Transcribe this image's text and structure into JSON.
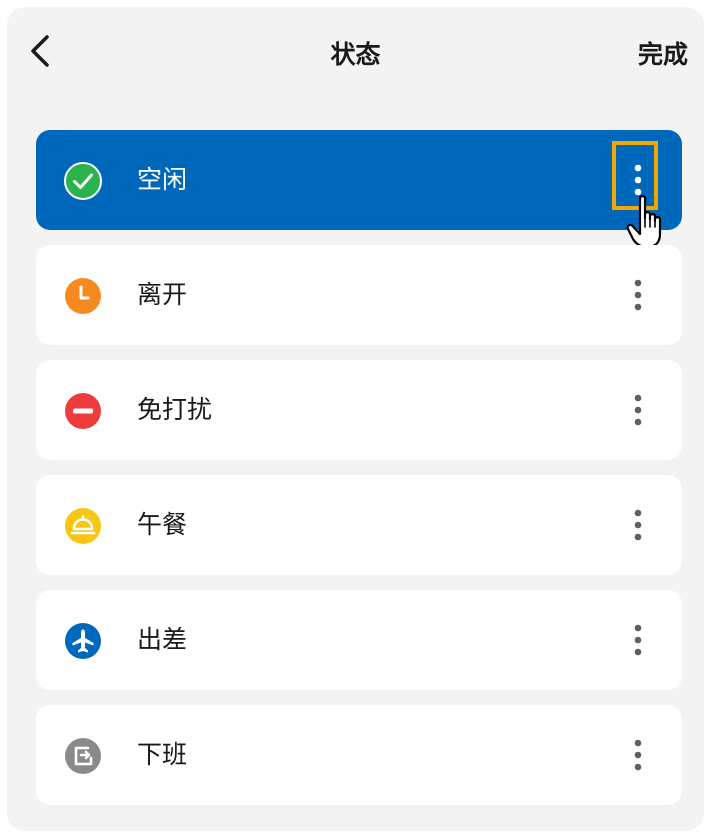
{
  "header": {
    "title": "状态",
    "done_label": "完成",
    "back_icon": "chevron-left-icon"
  },
  "statuses": [
    {
      "label": "空闲",
      "icon": "check-circle-icon",
      "color": "#2bb24c",
      "selected": true
    },
    {
      "label": "离开",
      "icon": "clock-icon",
      "color": "#f58a1f",
      "selected": false
    },
    {
      "label": "免打扰",
      "icon": "minus-circle-icon",
      "color": "#ef3b3b",
      "selected": false
    },
    {
      "label": "午餐",
      "icon": "meal-cover-icon",
      "color": "#f7c613",
      "selected": false
    },
    {
      "label": "出差",
      "icon": "airplane-icon",
      "color": "#0068bb",
      "selected": false
    },
    {
      "label": "下班",
      "icon": "exit-icon",
      "color": "#8a8a8a",
      "selected": false
    }
  ],
  "colors": {
    "selected_background": "#0068bb",
    "panel_background": "#f3f3f3",
    "highlight_border": "#f5a900"
  }
}
